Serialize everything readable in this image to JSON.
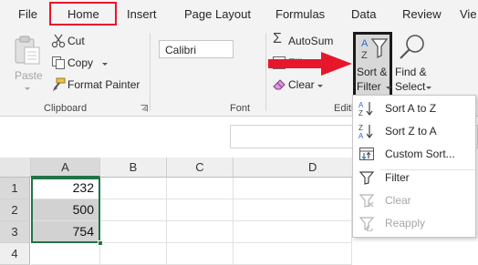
{
  "menu": {
    "tabs": [
      "File",
      "Home",
      "Insert",
      "Page Layout",
      "Formulas",
      "Data",
      "Review",
      "Vie"
    ],
    "active_tab": "Home"
  },
  "ribbon": {
    "clipboard": {
      "paste": "Paste",
      "cut": "Cut",
      "copy": "Copy",
      "format_painter": "Format Painter",
      "label": "Clipboard"
    },
    "font": {
      "font_name": "Calibri",
      "label": "Font"
    },
    "editing": {
      "autosum": "AutoSum",
      "fill": "Fill",
      "clear": "Clear",
      "sort_filter_line1": "Sort &",
      "sort_filter_line2": "Filter",
      "find_select_line1": "Find &",
      "find_select_line2": "Select",
      "label": "Editi"
    }
  },
  "grid": {
    "columns": [
      "A",
      "B",
      "C",
      "D"
    ],
    "rows": [
      {
        "num": "1",
        "a": "232"
      },
      {
        "num": "2",
        "a": "500"
      },
      {
        "num": "3",
        "a": "754"
      },
      {
        "num": "4",
        "a": ""
      }
    ]
  },
  "dropdown": {
    "items": [
      {
        "label": "Sort A to Z",
        "icon": "sort-a-to-z-icon",
        "enabled": true
      },
      {
        "label": "Sort Z to A",
        "icon": "sort-z-to-a-icon",
        "enabled": true
      },
      {
        "label": "Custom Sort...",
        "icon": "custom-sort-icon",
        "enabled": true
      },
      {
        "label": "Filter",
        "icon": "filter-icon",
        "enabled": true
      },
      {
        "label": "Clear",
        "icon": "clear-filter-icon",
        "enabled": false
      },
      {
        "label": "Reapply",
        "icon": "reapply-icon",
        "enabled": false
      }
    ]
  },
  "colors": {
    "highlight_box": "#e8162b",
    "arrow": "#e8162b",
    "selection": "#217346",
    "ribbon_bg": "#f3f3f3"
  }
}
